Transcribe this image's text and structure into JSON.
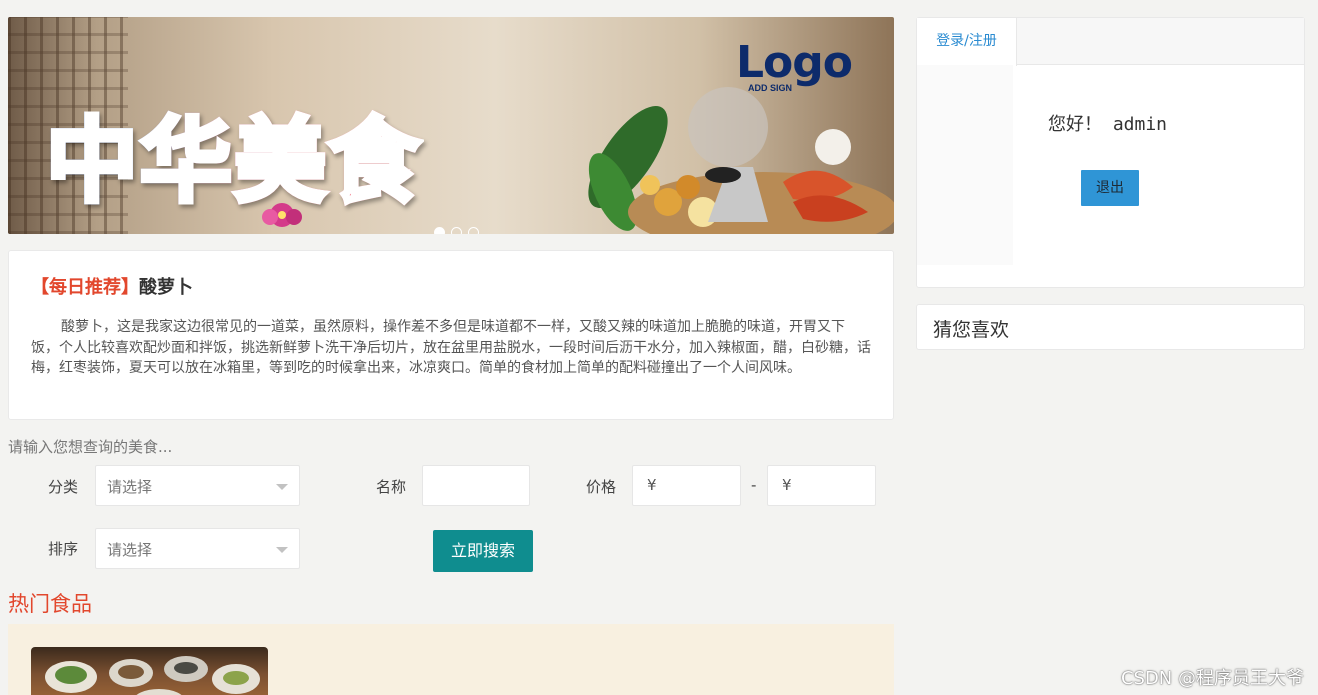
{
  "banner": {
    "title": "中华美食",
    "logo_text": "Logo",
    "logo_sub": "ADD SIGN",
    "slides": 3,
    "active_slide": 1
  },
  "recommend": {
    "tag": "【每日推荐】",
    "name": "酸萝卜",
    "description": "酸萝卜，这是我家这边很常见的一道菜，虽然原料，操作差不多但是味道都不一样，又酸又辣的味道加上脆脆的味道，开胃又下饭，个人比较喜欢配炒面和拌饭，挑选新鲜萝卜洗干净后切片，放在盆里用盐脱水，一段时间后沥干水分，加入辣椒面，醋，白砂糖，话梅，红枣装饰，夏天可以放在冰箱里，等到吃的时候拿出来，冰凉爽口。简单的食材加上简单的配料碰撞出了一个人间风味。"
  },
  "search": {
    "hint": "请输入您想查询的美食...",
    "category_label": "分类",
    "category_value": "请选择",
    "name_label": "名称",
    "name_value": "",
    "price_label": "价格",
    "price_min": "¥",
    "price_sep": "-",
    "price_max": "¥",
    "sort_label": "排序",
    "sort_value": "请选择",
    "submit_label": "立即搜索"
  },
  "hot": {
    "title": "热门食品"
  },
  "login": {
    "tab_label": "登录/注册",
    "greeting": "您好！ admin",
    "logout_label": "退出"
  },
  "guess": {
    "title": "猜您喜欢"
  },
  "watermark": "CSDN @程序员王大爷",
  "colors": {
    "accent_red": "#e2472d",
    "search_button": "#0f8d8f",
    "logout_button": "#2f95d6",
    "tab_text": "#2a8bd1"
  }
}
